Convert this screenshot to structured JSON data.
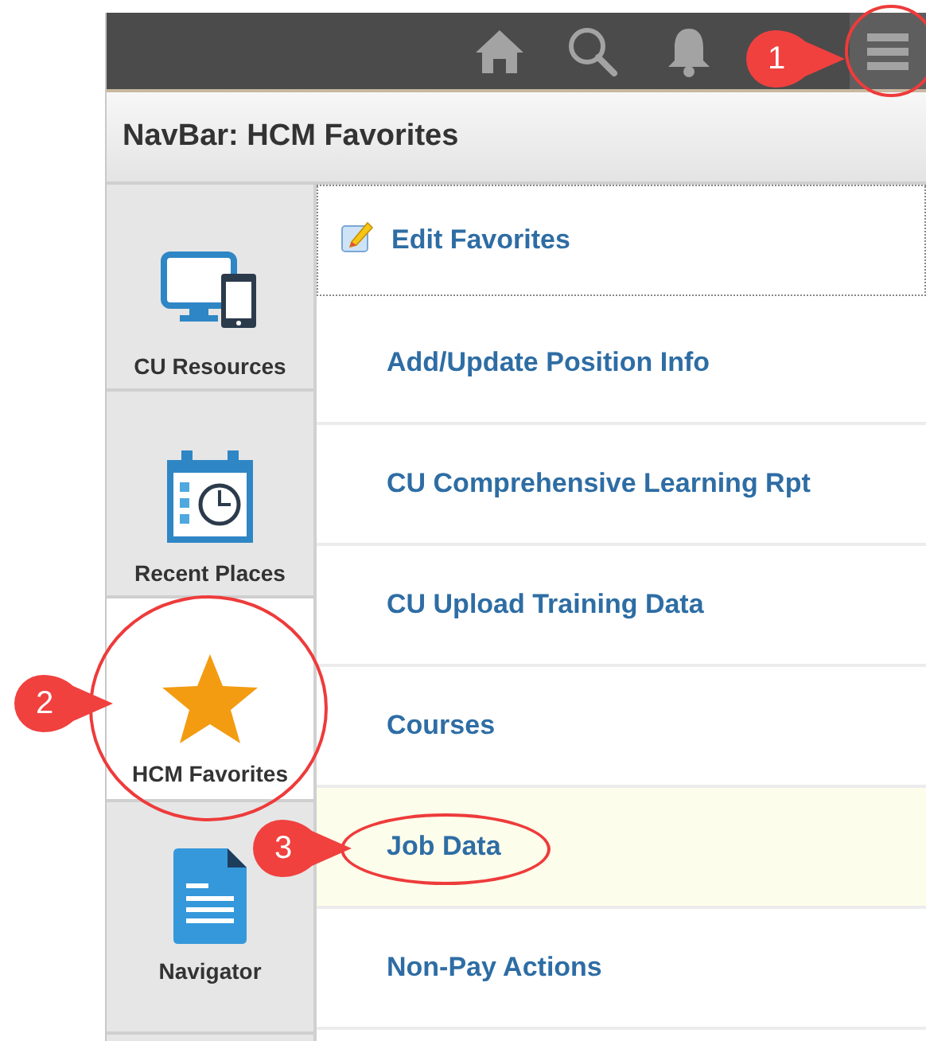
{
  "header": {
    "title": "NavBar: HCM Favorites"
  },
  "sidebar": {
    "items": [
      {
        "label": "CU Resources",
        "kind": "devices",
        "selected": false
      },
      {
        "label": "Recent Places",
        "kind": "recent",
        "selected": false
      },
      {
        "label": "HCM Favorites",
        "kind": "favorites",
        "selected": true
      },
      {
        "label": "Navigator",
        "kind": "navigator",
        "selected": false
      }
    ]
  },
  "favorites": {
    "edit_link": "Edit Favorites",
    "items": [
      {
        "label": "Add/Update Position Info",
        "highlighted": false
      },
      {
        "label": "CU Comprehensive Learning Rpt",
        "highlighted": false
      },
      {
        "label": "CU Upload Training Data",
        "highlighted": false
      },
      {
        "label": "Courses",
        "highlighted": false
      },
      {
        "label": "Job Data",
        "highlighted": true
      },
      {
        "label": "Non-Pay Actions",
        "highlighted": false
      }
    ]
  },
  "callouts": [
    {
      "label": "1"
    },
    {
      "label": "2"
    },
    {
      "label": "3"
    }
  ]
}
